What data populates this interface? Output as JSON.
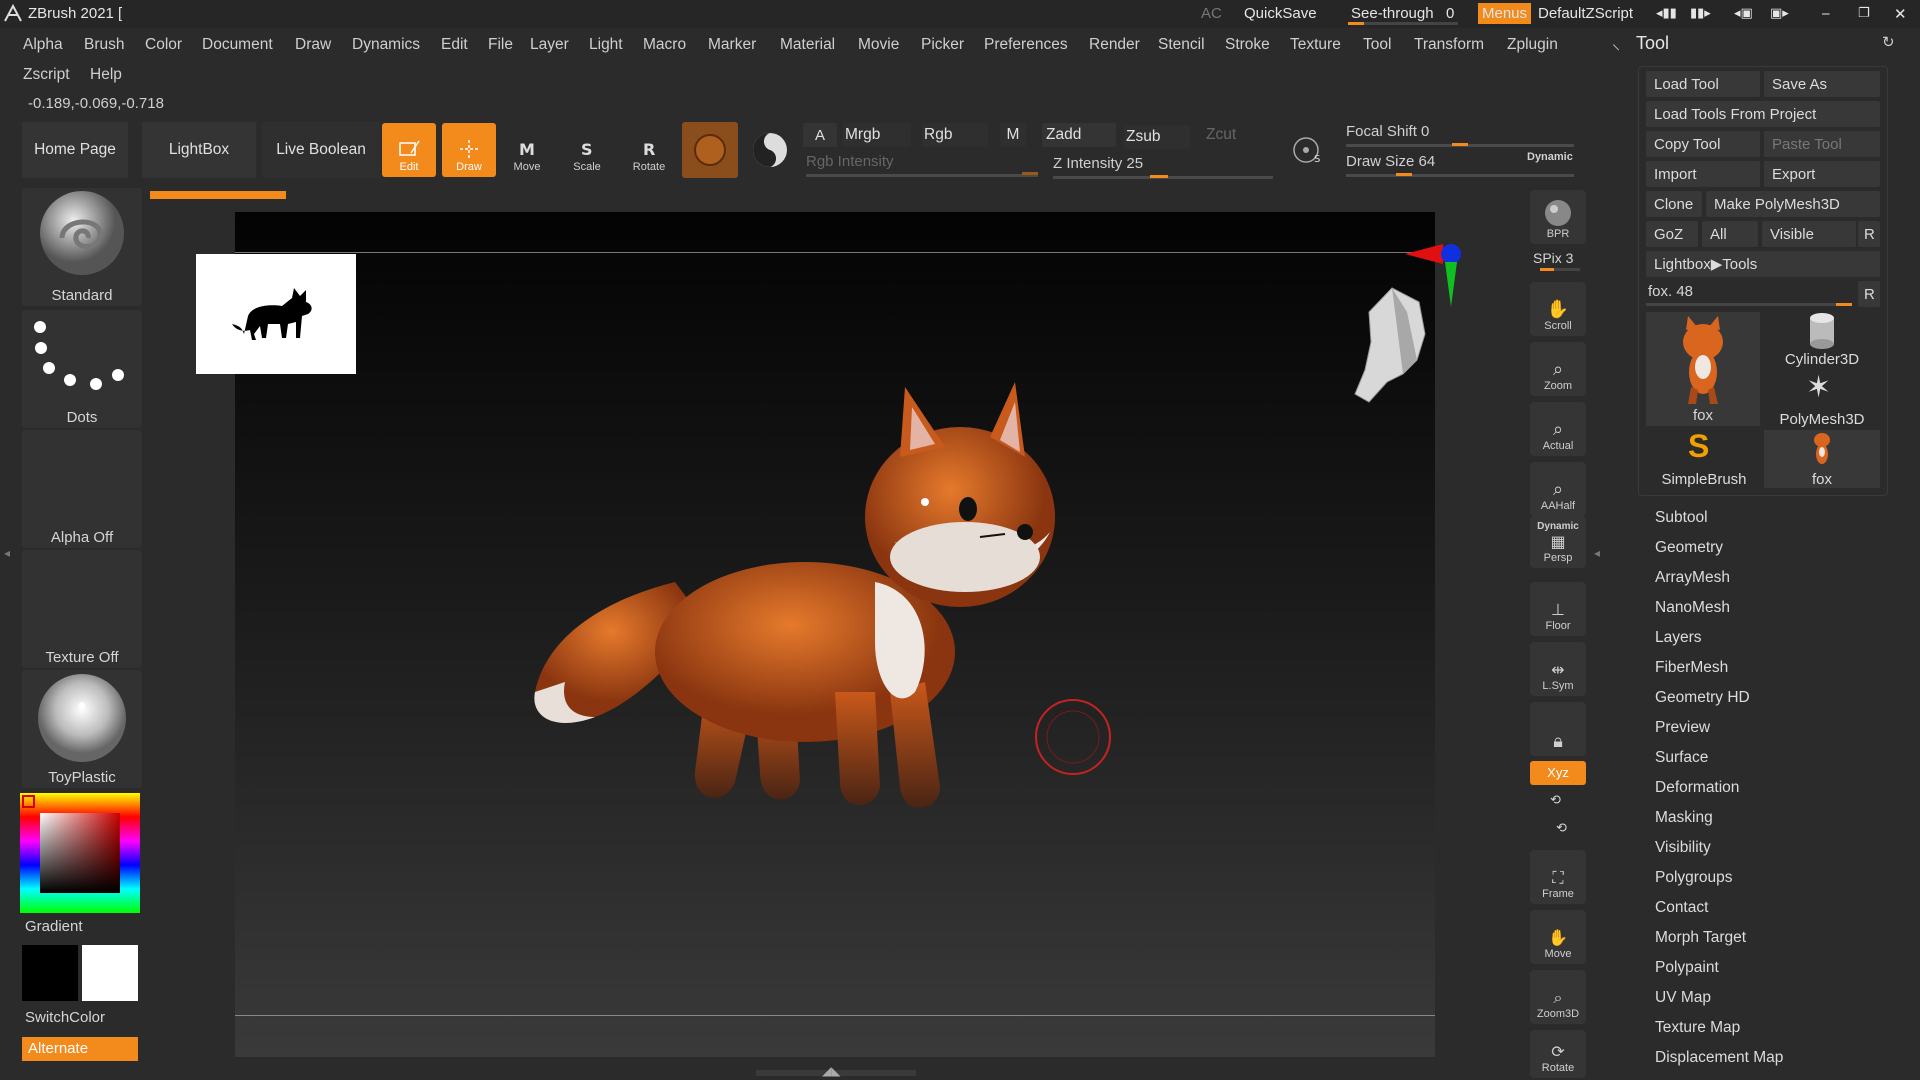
{
  "titlebar": {
    "app_title": "ZBrush 2021 [",
    "ac": "AC",
    "quicksave": "QuickSave",
    "see_through_label": "See-through",
    "see_through_value": "0",
    "menus": "Menus",
    "script": "DefaultZScript"
  },
  "menu": [
    "Alpha",
    "Brush",
    "Color",
    "Document",
    "Draw",
    "Dynamics",
    "Edit",
    "File",
    "Layer",
    "Light",
    "Macro",
    "Marker",
    "Material",
    "Movie",
    "Picker",
    "Preferences",
    "Render",
    "Stencil",
    "Stroke",
    "Texture",
    "Tool",
    "Transform",
    "Zplugin"
  ],
  "menu2": [
    "Zscript",
    "Help"
  ],
  "coords": "-0.189,-0.069,-0.718",
  "toolbar": {
    "home_page": "Home Page",
    "lightbox": "LightBox",
    "live_boolean": "Live Boolean",
    "edit": "Edit",
    "draw": "Draw",
    "move": "Move",
    "scale": "Scale",
    "rotate": "Rotate",
    "a": "A",
    "mrgb": "Mrgb",
    "rgb": "Rgb",
    "m": "M",
    "zadd": "Zadd",
    "zsub": "Zsub",
    "zcut": "Zcut",
    "rgb_intensity": "Rgb Intensity",
    "z_intensity": "Z Intensity 25",
    "focal_shift": "Focal Shift 0",
    "draw_size": "Draw Size 64",
    "dynamic": "Dynamic"
  },
  "left": {
    "brush": "Standard",
    "stroke": "Dots",
    "alpha": "Alpha Off",
    "texture": "Texture Off",
    "material": "ToyPlastic",
    "gradient": "Gradient",
    "switch_color": "SwitchColor",
    "alternate": "Alternate"
  },
  "right_shelf": {
    "bpr": "BPR",
    "spix": "SPix 3",
    "scroll": "Scroll",
    "zoom": "Zoom",
    "actual": "Actual",
    "aahalf": "AAHalf",
    "persp_top": "Dynamic",
    "persp": "Persp",
    "floor": "Floor",
    "lsym": "L.Sym",
    "xyz": "Xyz",
    "frame": "Frame",
    "move": "Move",
    "zoom3d": "Zoom3D",
    "rotate": "Rotate"
  },
  "tool_panel": {
    "title": "Tool",
    "load_tool": "Load Tool",
    "save_as": "Save As",
    "load_from_project": "Load Tools From Project",
    "copy_tool": "Copy Tool",
    "paste_tool": "Paste Tool",
    "import": "Import",
    "export": "Export",
    "clone": "Clone",
    "make_polymesh": "Make PolyMesh3D",
    "goz": "GoZ",
    "all": "All",
    "visible": "Visible",
    "r": "R",
    "lightbox_tools": "Lightbox▶Tools",
    "fox_slider": "fox. 48",
    "thumbs": [
      "fox",
      "Cylinder3D",
      "PolyMesh3D",
      "SimpleBrush",
      "fox"
    ],
    "items": [
      "Subtool",
      "Geometry",
      "ArrayMesh",
      "NanoMesh",
      "Layers",
      "FiberMesh",
      "Geometry HD",
      "Preview",
      "Surface",
      "Deformation",
      "Masking",
      "Visibility",
      "Polygroups",
      "Contact",
      "Morph Target",
      "Polypaint",
      "UV Map",
      "Texture Map",
      "Displacement Map"
    ]
  },
  "colors": {
    "accent": "#f28a1c",
    "bg": "#2b2b2b",
    "fox": "#d35f1b"
  }
}
